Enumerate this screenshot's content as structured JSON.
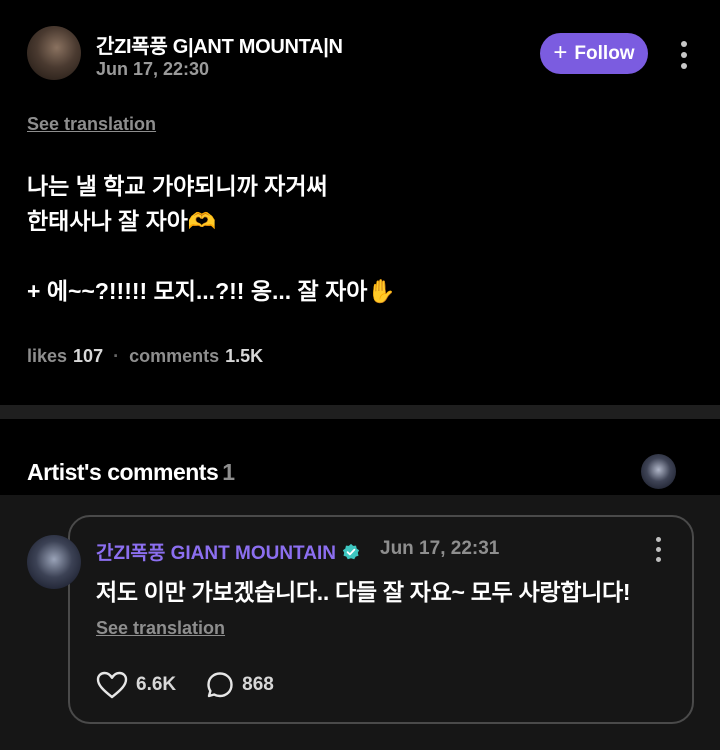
{
  "post": {
    "author": "간ZI폭풍 G|ANT MOUNTA|N",
    "time": "Jun 17, 22:30",
    "follow_label": "Follow",
    "see_translation": "See translation",
    "lines": [
      "나는 낼 학교 가야되니까 자거써",
      "한태사나 잘 자아🫶",
      "",
      "+ 에~~?!!!!! 모지...?!! 옹... 잘 자아✋"
    ],
    "likes_label": "likes",
    "likes_count": "107",
    "comments_label": "comments",
    "comments_count": "1.5K"
  },
  "artist_comments": {
    "title": "Artist's comments",
    "count": "1"
  },
  "comment": {
    "author": "간ZI폭풍 GIANT MOUNTAIN",
    "time": "Jun 17, 22:31",
    "text": "저도 이만 가보겠습니다.. 다들 잘 자요~ 모두 사랑합니다!",
    "see_translation": "See translation",
    "likes": "6.6K",
    "replies": "868"
  },
  "colors": {
    "accent": "#7b5ce0",
    "author_purple": "#8c6ff0",
    "verified": "#3ec6c0"
  },
  "icons": [
    "plus-icon",
    "more-icon",
    "verified-icon",
    "heart-icon",
    "reply-icon"
  ]
}
